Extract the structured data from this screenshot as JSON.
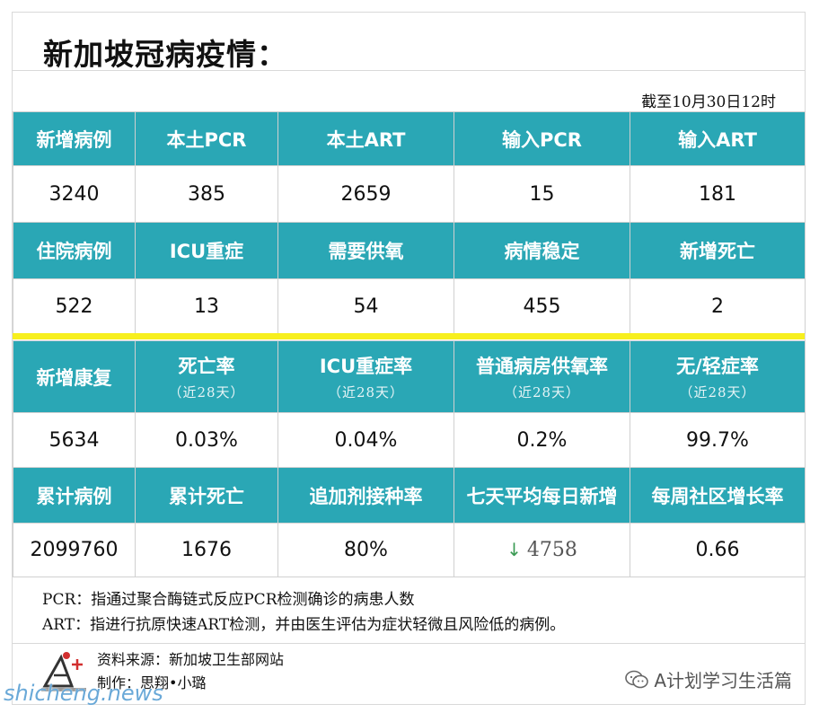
{
  "title": "新加坡冠病疫情：",
  "as_of": "截至10月30日12时",
  "table1": {
    "rows": [
      {
        "type": "header",
        "cells": [
          "新增病例",
          "本土PCR",
          "本土ART",
          "输入PCR",
          "输入ART"
        ]
      },
      {
        "type": "value",
        "cells": [
          "3240",
          "385",
          "2659",
          "15",
          "181"
        ]
      },
      {
        "type": "header",
        "cells": [
          "住院病例",
          "ICU重症",
          "需要供氧",
          "病情稳定",
          "新增死亡"
        ]
      },
      {
        "type": "value",
        "cells": [
          "522",
          "13",
          "54",
          "455",
          "2"
        ]
      }
    ]
  },
  "table2": {
    "row1_headers": [
      "新增康复",
      "死亡率",
      "ICU重症率",
      "普通病房供氧率",
      "无/轻症率"
    ],
    "row1_sub": "（近28天）",
    "row1_values": [
      "5634",
      "0.03%",
      "0.04%",
      "0.2%",
      "99.7%"
    ],
    "row2_headers": [
      "累计病例",
      "累计死亡",
      "追加剂接种率",
      "七天平均每日新增",
      "每周社区增长率"
    ],
    "row2_values": [
      "2099760",
      "1676",
      "80%",
      "4758",
      "0.66"
    ],
    "trend_arrow": "↓"
  },
  "notes": [
    "PCR：指通过聚合酶链式反应PCR检测确诊的病患人数",
    "ART：指进行抗原快速ART检测，并由医生评估为症状轻微且风险低的病例。"
  ],
  "source": {
    "line1": "资料来源：新加坡卫生部网站",
    "line2": "制作：思翔•小璐"
  },
  "wechat_account": "A计划学习生活篇",
  "watermark": "shicheng.news",
  "colors": {
    "header_bg": "#2aa7b5",
    "divider": "#f7ef1e",
    "green": "#22a04b"
  }
}
